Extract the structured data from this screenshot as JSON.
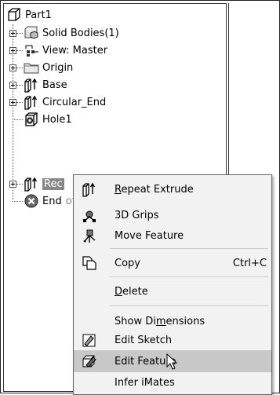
{
  "tree": {
    "root": "Part1",
    "items": [
      {
        "label": "Solid Bodies(1)"
      },
      {
        "label": "View: Master"
      },
      {
        "label": "Origin"
      },
      {
        "label": "Base"
      },
      {
        "label": "Circular_End"
      },
      {
        "label": "Hole1"
      },
      {
        "label": "Rec"
      },
      {
        "label": "End"
      },
      {
        "label": "of Part"
      }
    ]
  },
  "menu": {
    "repeat_extrude": {
      "pre": "",
      "u": "R",
      "post": "epeat Extrude"
    },
    "grips": "3D Grips",
    "move_feature": "Move Feature",
    "copy": "Copy",
    "copy_shortcut": "Ctrl+C",
    "delete": {
      "pre": "",
      "u": "D",
      "post": "elete"
    },
    "show_dimensions": {
      "pre": "Show Di",
      "u": "m",
      "post": "ensions"
    },
    "edit_sketch": "Edit Sketch",
    "edit_feature": "Edit Feature",
    "infer_imates": "Infer iMates"
  },
  "colors": {
    "menu_bg": "#f2f2f2",
    "highlight": "#c8c8c8",
    "selection": "#888888"
  }
}
